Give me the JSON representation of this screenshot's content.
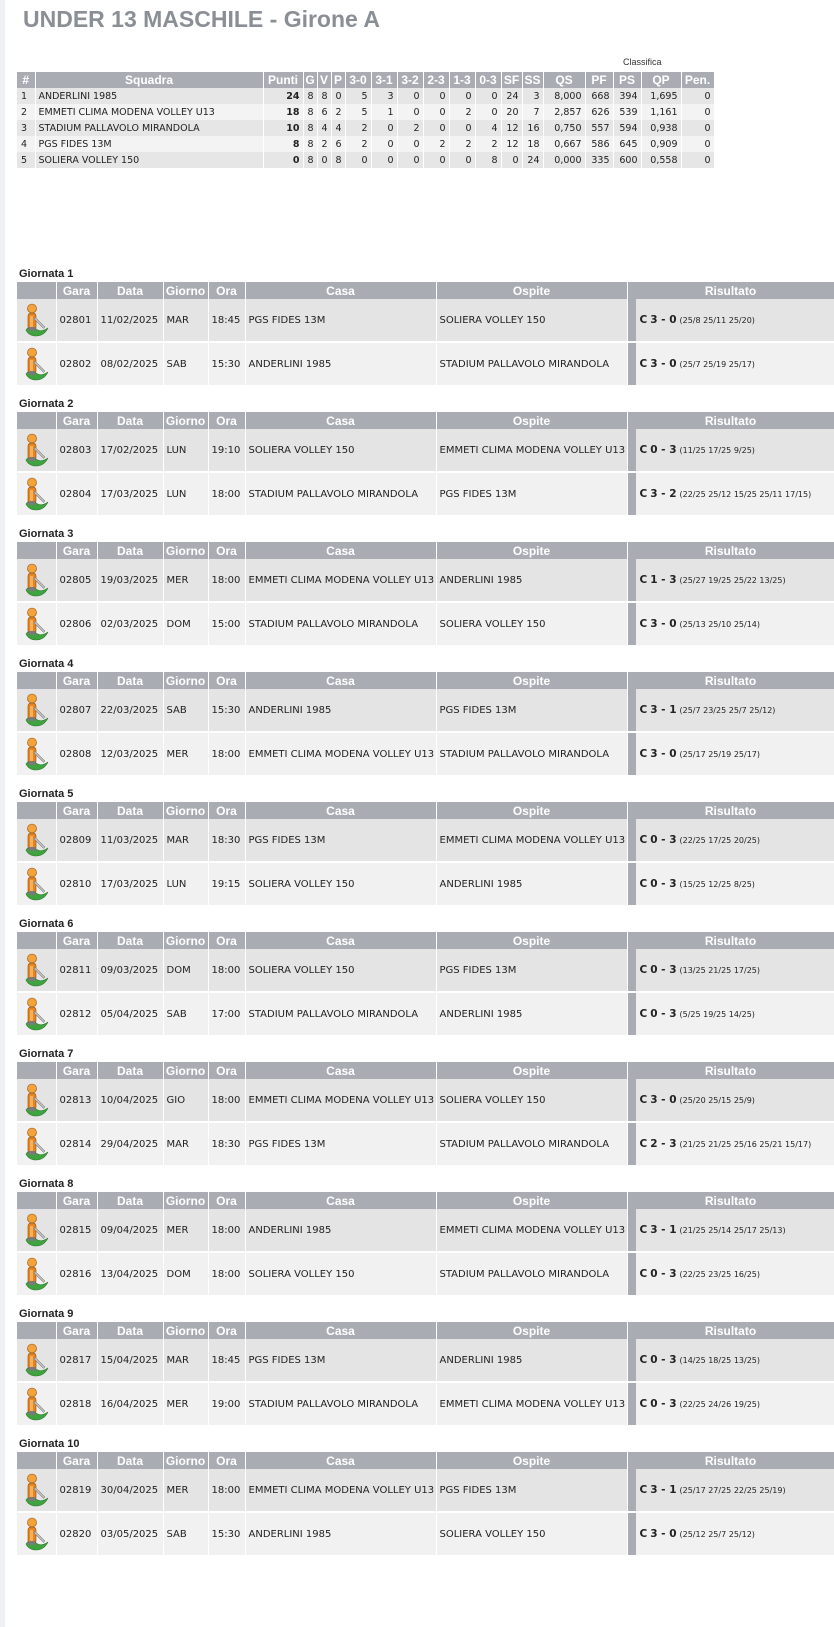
{
  "title": "UNDER 13 MASCHILE - Girone A",
  "standings_caption": "Classifica",
  "standings_headers": [
    "#",
    "Squadra",
    "Punti",
    "G",
    "V",
    "P",
    "3-0",
    "3-1",
    "3-2",
    "2-3",
    "1-3",
    "0-3",
    "SF",
    "SS",
    "QS",
    "PF",
    "PS",
    "QP",
    "Pen."
  ],
  "standings": [
    [
      "1",
      "ANDERLINI 1985",
      "24",
      "8",
      "8",
      "0",
      "5",
      "3",
      "0",
      "0",
      "0",
      "0",
      "24",
      "3",
      "8,000",
      "668",
      "394",
      "1,695",
      "0"
    ],
    [
      "2",
      "EMMETI CLIMA MODENA VOLLEY U13",
      "18",
      "8",
      "6",
      "2",
      "5",
      "1",
      "0",
      "0",
      "2",
      "0",
      "20",
      "7",
      "2,857",
      "626",
      "539",
      "1,161",
      "0"
    ],
    [
      "3",
      "STADIUM PALLAVOLO MIRANDOLA",
      "10",
      "8",
      "4",
      "4",
      "2",
      "0",
      "2",
      "0",
      "0",
      "4",
      "12",
      "16",
      "0,750",
      "557",
      "594",
      "0,938",
      "0"
    ],
    [
      "4",
      "PGS FIDES 13M",
      "8",
      "8",
      "2",
      "6",
      "2",
      "0",
      "0",
      "2",
      "2",
      "2",
      "12",
      "18",
      "0,667",
      "586",
      "645",
      "0,909",
      "0"
    ],
    [
      "5",
      "SOLIERA VOLLEY 150",
      "0",
      "8",
      "0",
      "8",
      "0",
      "0",
      "0",
      "0",
      "0",
      "8",
      "0",
      "24",
      "0,000",
      "335",
      "600",
      "0,558",
      "0"
    ]
  ],
  "match_headers": [
    "",
    "Gara",
    "Data",
    "Giorno",
    "Ora",
    "Casa",
    "Ospite",
    "Risultato"
  ],
  "rounds": [
    {
      "title": "Giornata 1",
      "matches": [
        {
          "gara": "02801",
          "data": "11/02/2025",
          "giorno": "MAR",
          "ora": "18:45",
          "casa": "PGS FIDES 13M",
          "ospite": "SOLIERA VOLLEY 150",
          "status": "C",
          "score": "3 - 0",
          "sets": "(25/8 25/11 25/20)"
        },
        {
          "gara": "02802",
          "data": "08/02/2025",
          "giorno": "SAB",
          "ora": "15:30",
          "casa": "ANDERLINI 1985",
          "ospite": "STADIUM PALLAVOLO MIRANDOLA",
          "status": "C",
          "score": "3 - 0",
          "sets": "(25/7 25/19 25/17)"
        }
      ]
    },
    {
      "title": "Giornata 2",
      "matches": [
        {
          "gara": "02803",
          "data": "17/02/2025",
          "giorno": "LUN",
          "ora": "19:10",
          "casa": "SOLIERA VOLLEY 150",
          "ospite": "EMMETI CLIMA MODENA VOLLEY U13",
          "status": "C",
          "score": "0 - 3",
          "sets": "(11/25 17/25 9/25)"
        },
        {
          "gara": "02804",
          "data": "17/03/2025",
          "giorno": "LUN",
          "ora": "18:00",
          "casa": "STADIUM PALLAVOLO MIRANDOLA",
          "ospite": "PGS FIDES 13M",
          "status": "C",
          "score": "3 - 2",
          "sets": "(22/25 25/12 15/25 25/11 17/15)"
        }
      ]
    },
    {
      "title": "Giornata 3",
      "matches": [
        {
          "gara": "02805",
          "data": "19/03/2025",
          "giorno": "MER",
          "ora": "18:00",
          "casa": "EMMETI CLIMA MODENA VOLLEY U13",
          "ospite": "ANDERLINI 1985",
          "status": "C",
          "score": "1 - 3",
          "sets": "(25/27 19/25 25/22 13/25)"
        },
        {
          "gara": "02806",
          "data": "02/03/2025",
          "giorno": "DOM",
          "ora": "15:00",
          "casa": "STADIUM PALLAVOLO MIRANDOLA",
          "ospite": "SOLIERA VOLLEY 150",
          "status": "C",
          "score": "3 - 0",
          "sets": "(25/13 25/10 25/14)"
        }
      ]
    },
    {
      "title": "Giornata 4",
      "matches": [
        {
          "gara": "02807",
          "data": "22/03/2025",
          "giorno": "SAB",
          "ora": "15:30",
          "casa": "ANDERLINI 1985",
          "ospite": "PGS FIDES 13M",
          "status": "C",
          "score": "3 - 1",
          "sets": "(25/7 23/25 25/7 25/12)"
        },
        {
          "gara": "02808",
          "data": "12/03/2025",
          "giorno": "MER",
          "ora": "18:00",
          "casa": "EMMETI CLIMA MODENA VOLLEY U13",
          "ospite": "STADIUM PALLAVOLO MIRANDOLA",
          "status": "C",
          "score": "3 - 0",
          "sets": "(25/17 25/19 25/17)"
        }
      ]
    },
    {
      "title": "Giornata 5",
      "matches": [
        {
          "gara": "02809",
          "data": "11/03/2025",
          "giorno": "MAR",
          "ora": "18:30",
          "casa": "PGS FIDES 13M",
          "ospite": "EMMETI CLIMA MODENA VOLLEY U13",
          "status": "C",
          "score": "0 - 3",
          "sets": "(22/25 17/25 20/25)"
        },
        {
          "gara": "02810",
          "data": "17/03/2025",
          "giorno": "LUN",
          "ora": "19:15",
          "casa": "SOLIERA VOLLEY 150",
          "ospite": "ANDERLINI 1985",
          "status": "C",
          "score": "0 - 3",
          "sets": "(15/25 12/25 8/25)"
        }
      ]
    },
    {
      "title": "Giornata 6",
      "matches": [
        {
          "gara": "02811",
          "data": "09/03/2025",
          "giorno": "DOM",
          "ora": "18:00",
          "casa": "SOLIERA VOLLEY 150",
          "ospite": "PGS FIDES 13M",
          "status": "C",
          "score": "0 - 3",
          "sets": "(13/25 21/25 17/25)"
        },
        {
          "gara": "02812",
          "data": "05/04/2025",
          "giorno": "SAB",
          "ora": "17:00",
          "casa": "STADIUM PALLAVOLO MIRANDOLA",
          "ospite": "ANDERLINI 1985",
          "status": "C",
          "score": "0 - 3",
          "sets": "(5/25 19/25 14/25)"
        }
      ]
    },
    {
      "title": "Giornata 7",
      "matches": [
        {
          "gara": "02813",
          "data": "10/04/2025",
          "giorno": "GIO",
          "ora": "18:00",
          "casa": "EMMETI CLIMA MODENA VOLLEY U13",
          "ospite": "SOLIERA VOLLEY 150",
          "status": "C",
          "score": "3 - 0",
          "sets": "(25/20 25/15 25/9)"
        },
        {
          "gara": "02814",
          "data": "29/04/2025",
          "giorno": "MAR",
          "ora": "18:30",
          "casa": "PGS FIDES 13M",
          "ospite": "STADIUM PALLAVOLO MIRANDOLA",
          "status": "C",
          "score": "2 - 3",
          "sets": "(21/25 21/25 25/16 25/21 15/17)"
        }
      ]
    },
    {
      "title": "Giornata 8",
      "matches": [
        {
          "gara": "02815",
          "data": "09/04/2025",
          "giorno": "MER",
          "ora": "18:00",
          "casa": "ANDERLINI 1985",
          "ospite": "EMMETI CLIMA MODENA VOLLEY U13",
          "status": "C",
          "score": "3 - 1",
          "sets": "(21/25 25/14 25/17 25/13)"
        },
        {
          "gara": "02816",
          "data": "13/04/2025",
          "giorno": "DOM",
          "ora": "18:00",
          "casa": "SOLIERA VOLLEY 150",
          "ospite": "STADIUM PALLAVOLO MIRANDOLA",
          "status": "C",
          "score": "0 - 3",
          "sets": "(22/25 23/25 16/25)"
        }
      ]
    },
    {
      "title": "Giornata 9",
      "matches": [
        {
          "gara": "02817",
          "data": "15/04/2025",
          "giorno": "MAR",
          "ora": "18:45",
          "casa": "PGS FIDES 13M",
          "ospite": "ANDERLINI 1985",
          "status": "C",
          "score": "0 - 3",
          "sets": "(14/25 18/25 13/25)"
        },
        {
          "gara": "02818",
          "data": "16/04/2025",
          "giorno": "MER",
          "ora": "19:00",
          "casa": "STADIUM PALLAVOLO MIRANDOLA",
          "ospite": "EMMETI CLIMA MODENA VOLLEY U13",
          "status": "C",
          "score": "0 - 3",
          "sets": "(22/25 24/26 19/25)"
        }
      ]
    },
    {
      "title": "Giornata 10",
      "matches": [
        {
          "gara": "02819",
          "data": "30/04/2025",
          "giorno": "MER",
          "ora": "18:00",
          "casa": "EMMETI CLIMA MODENA VOLLEY U13",
          "ospite": "PGS FIDES 13M",
          "status": "C",
          "score": "3 - 1",
          "sets": "(25/17 27/25 22/25 25/19)"
        },
        {
          "gara": "02820",
          "data": "03/05/2025",
          "giorno": "SAB",
          "ora": "15:30",
          "casa": "ANDERLINI 1985",
          "ospite": "SOLIERA VOLLEY 150",
          "status": "C",
          "score": "3 - 0",
          "sets": "(25/12 25/7 25/12)"
        }
      ]
    }
  ],
  "icons": {
    "referee": "referee-icon"
  },
  "colors": {
    "header_bg": "#a9adb3",
    "row_dark": "#e4e4e4",
    "row_light": "#f1f1f1",
    "title": "#8a8e95"
  }
}
